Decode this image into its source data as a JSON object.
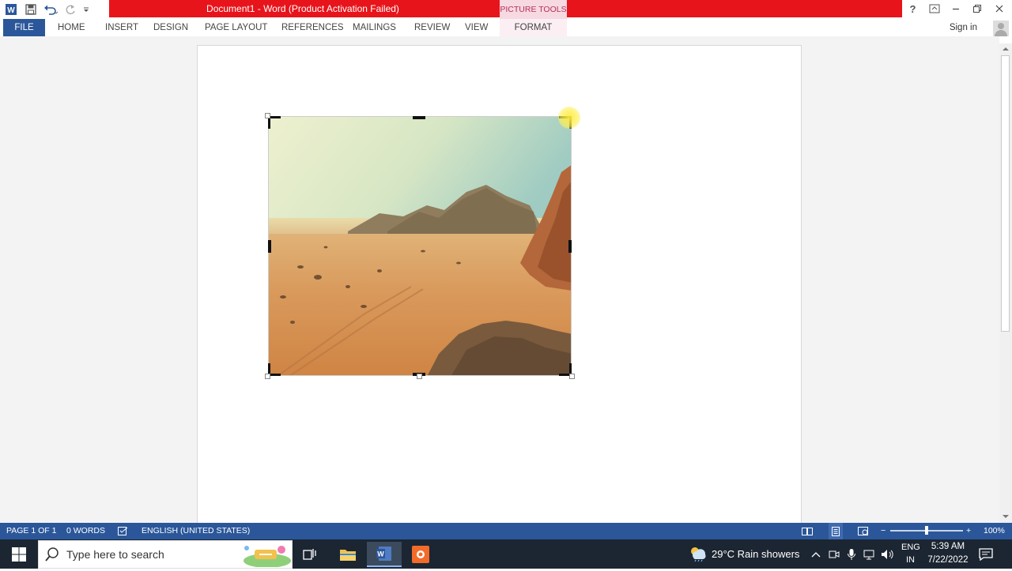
{
  "titlebar": {
    "title": "Document1 -  Word (Product Activation Failed)",
    "context_tab_group": "PICTURE TOOLS",
    "help_label": "?",
    "accent_color": "#e8141b"
  },
  "ribbon": {
    "tabs": [
      "FILE",
      "HOME",
      "INSERT",
      "DESIGN",
      "PAGE LAYOUT",
      "REFERENCES",
      "MAILINGS",
      "REVIEW",
      "VIEW",
      "FORMAT"
    ],
    "sign_in": "Sign in",
    "file_color": "#2b579a"
  },
  "document": {
    "picture": {
      "name": "desert landscape photo",
      "mode": "crop"
    }
  },
  "statusbar": {
    "page": "PAGE 1 OF 1",
    "words": "0 WORDS",
    "language": "ENGLISH (UNITED STATES)",
    "zoom": "100%",
    "zoom_fraction": 0.5
  },
  "taskbar": {
    "search_placeholder": "Type here to search",
    "weather": "29°C  Rain showers",
    "lang_line1": "ENG",
    "lang_line2": "IN",
    "time": "5:39 AM",
    "date": "7/22/2022"
  }
}
